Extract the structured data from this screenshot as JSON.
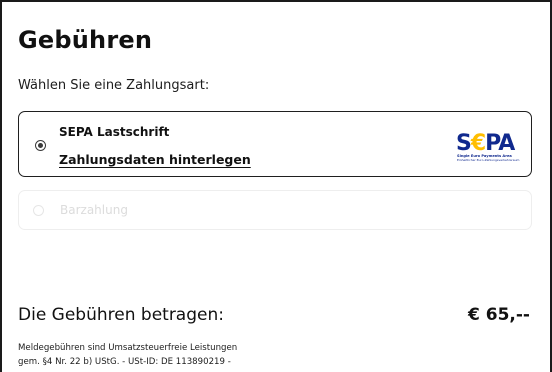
{
  "page": {
    "title": "Gebühren",
    "subtitle": "Wählen Sie eine Zahlungsart:"
  },
  "payment_options": [
    {
      "name": "SEPA Lastschrift",
      "link": "Zahlungsdaten hinterlegen",
      "selected": true,
      "logo": {
        "text_s": "S",
        "text_e": "€",
        "text_pa": "PA",
        "tagline": "Single Euro Payments Area",
        "subline": "Einheitlicher Euro-Zahlungsverkehrsraum",
        "primary_color": "#10298e",
        "accent_color": "#ffbe00"
      }
    },
    {
      "name": "Barzahlung",
      "selected": false,
      "disabled": true
    }
  ],
  "fees": {
    "label": "Die Gebühren betragen:",
    "amount": "€ 65,--"
  },
  "note": {
    "line1": "Meldegebühren sind Umsatzsteuerfreie Leistungen",
    "line2": "gem. §4 Nr. 22 b) UStG. - USt-ID: DE 113890219 -"
  }
}
